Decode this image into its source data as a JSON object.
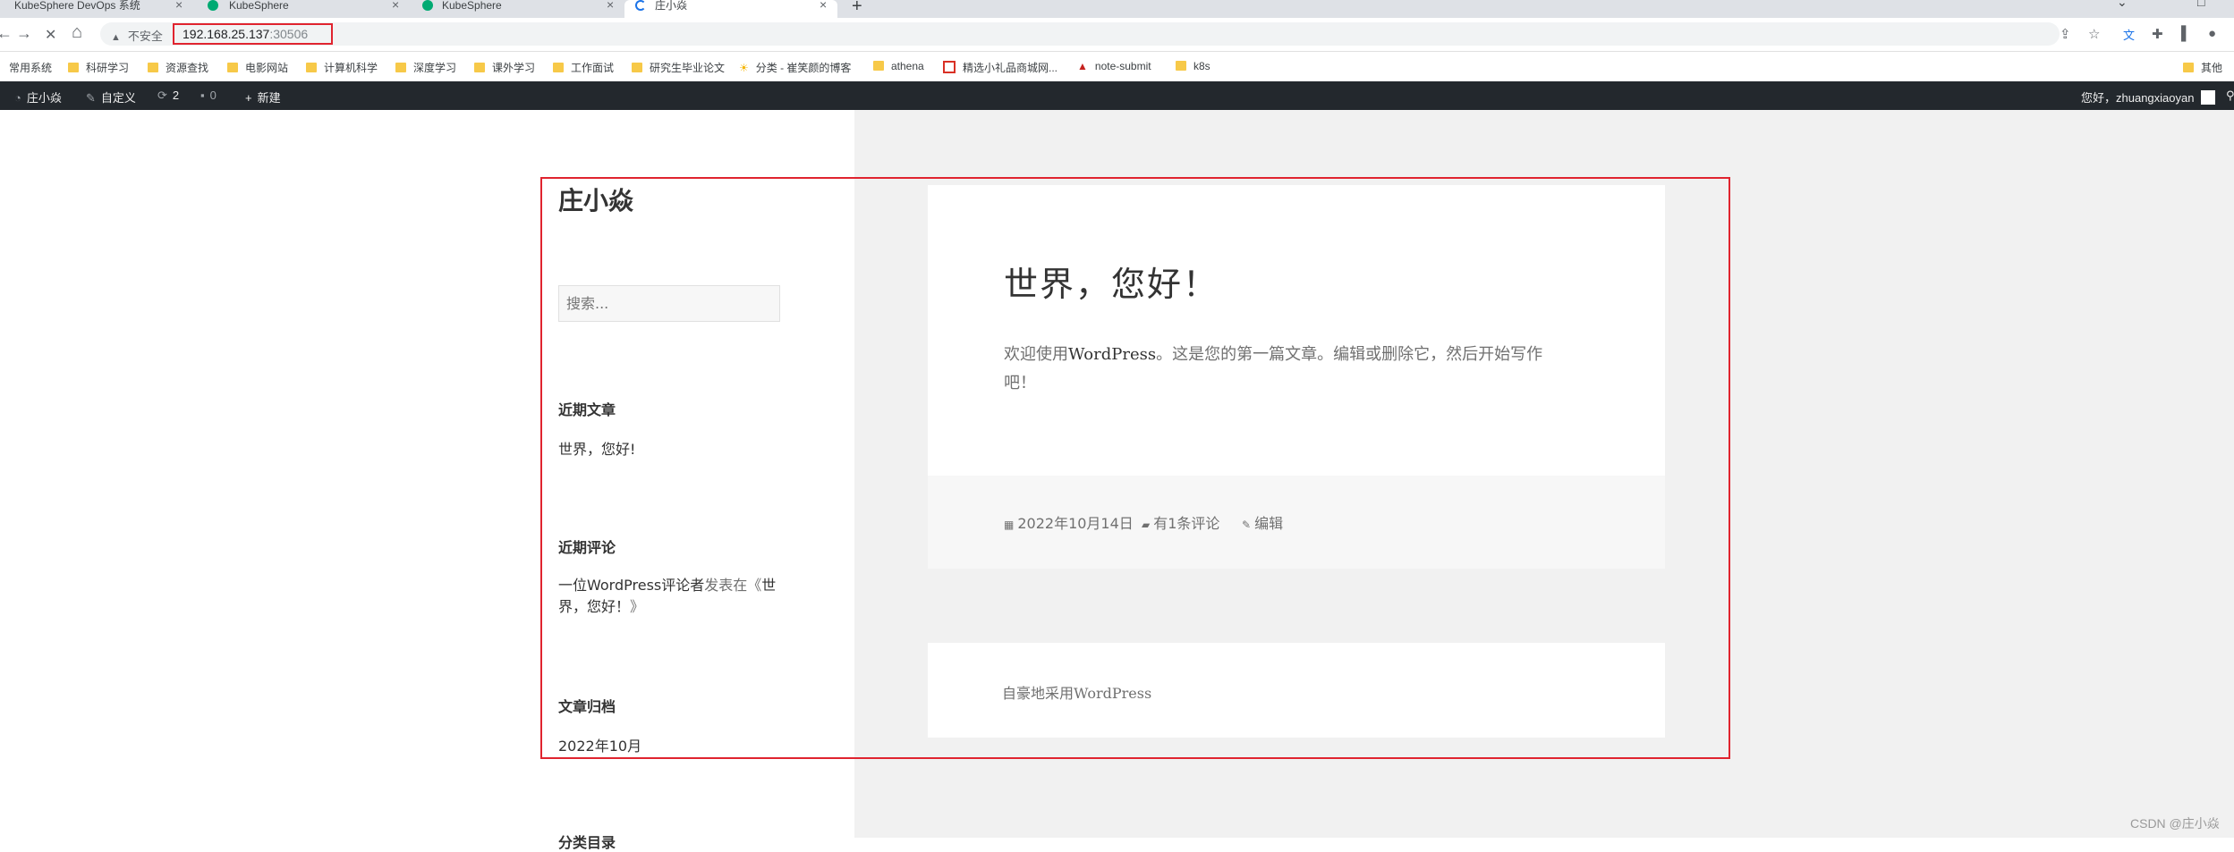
{
  "tabs": [
    {
      "title": "KubeSphere DevOps 系统",
      "close": "×"
    },
    {
      "title": "KubeSphere",
      "close": "×"
    },
    {
      "title": "KubeSphere",
      "close": "×"
    },
    {
      "title": "庄小焱",
      "close": "×"
    }
  ],
  "new_tab": "+",
  "window_controls": {
    "minimize": "⌄",
    "restore": "□"
  },
  "nav": {
    "back": "←",
    "forward": "→",
    "stop": "✕",
    "home": "⌂"
  },
  "omnibox": {
    "security_label": "不安全",
    "warning": "▲",
    "host": "192.168.25.137",
    "port": ":30506"
  },
  "toolbar_icons": {
    "share": "⇪",
    "star": "☆",
    "translate": "文",
    "extensions": "✚",
    "sidebar": "▌",
    "profile": "●"
  },
  "bookmarks": [
    {
      "label": "常用系统"
    },
    {
      "label": "科研学习"
    },
    {
      "label": "资源查找"
    },
    {
      "label": "电影网站"
    },
    {
      "label": "计算机科学"
    },
    {
      "label": "深度学习"
    },
    {
      "label": "课外学习"
    },
    {
      "label": "工作面试"
    },
    {
      "label": "研究生毕业论文"
    },
    {
      "label": "分类 - 崔笑颜的博客"
    },
    {
      "label": "athena"
    },
    {
      "label": "精选小礼品商城网..."
    },
    {
      "label": "note-submit"
    },
    {
      "label": "k8s"
    },
    {
      "label": "其他"
    }
  ],
  "adminbar": {
    "site_name": "庄小焱",
    "customize": "自定义",
    "updates": "2",
    "comments": "0",
    "new": "新建",
    "greeting": "您好，zhuangxiaoyan"
  },
  "sidebar": {
    "site_title": "庄小焱",
    "search_placeholder": "搜索...",
    "recent_posts_title": "近期文章",
    "recent_post": "世界，您好!",
    "recent_comments_title": "近期评论",
    "comment_line1_author": "一位WordPress评论者",
    "comment_line1_mid": "发表在《",
    "comment_line1_post": "世",
    "comment_line2_post": "界，您好！",
    "comment_line2_end": "》",
    "archives_title": "文章归档",
    "archive_item": "2022年10月",
    "categories_title": "分类目录"
  },
  "post": {
    "title": "世界，您好！",
    "body_part1": "欢迎使用",
    "body_wp": "WordPress",
    "body_part2": "。这是您的第一篇文章。编辑或删除它，然后开始写作",
    "body_line2": "吧！",
    "date": "2022年10月14日",
    "comments_link": "有1条评论",
    "edit_link": "编辑"
  },
  "footer": {
    "powered": "自豪地采用WordPress"
  },
  "watermark": "CSDN @庄小焱"
}
